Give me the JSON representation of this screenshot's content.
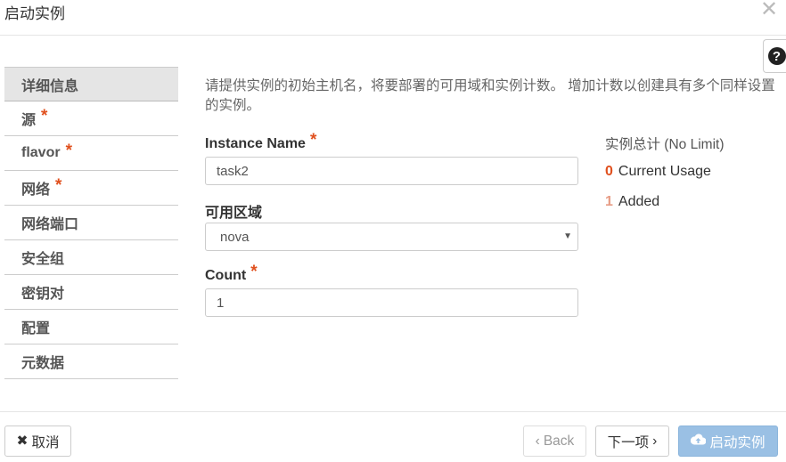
{
  "dialog": {
    "title": "启动实例",
    "close_icon": "✕"
  },
  "help": {
    "glyph": "?"
  },
  "nav": {
    "items": [
      {
        "label": "详细信息",
        "required": ""
      },
      {
        "label": "源",
        "required": "*"
      },
      {
        "label": "flavor",
        "required": "*"
      },
      {
        "label": "网络",
        "required": "*"
      },
      {
        "label": "网络端口",
        "required": ""
      },
      {
        "label": "安全组",
        "required": ""
      },
      {
        "label": "密钥对",
        "required": ""
      },
      {
        "label": "配置",
        "required": ""
      },
      {
        "label": "元数据",
        "required": ""
      }
    ]
  },
  "main": {
    "description": "请提供实例的初始主机名，将要部署的可用域和实例计数。 增加计数以创建具有多个同样设置的实例。",
    "instance_name": {
      "label": "Instance Name",
      "required": "*",
      "value": "task2"
    },
    "availability_zone": {
      "label": "可用区域",
      "value": "nova"
    },
    "count": {
      "label": "Count",
      "required": "*",
      "value": "1"
    }
  },
  "summary": {
    "title": "实例总计 (No Limit)",
    "current_usage_value": "0",
    "current_usage_label": "Current Usage",
    "added_value": "1",
    "added_label": "Added"
  },
  "footer": {
    "cancel_label": "取消",
    "back_label": "Back",
    "next_label": "下一项",
    "launch_label": "启动实例"
  },
  "colors": {
    "required": "#e0501e",
    "primary_button": "#9ac0e4"
  }
}
